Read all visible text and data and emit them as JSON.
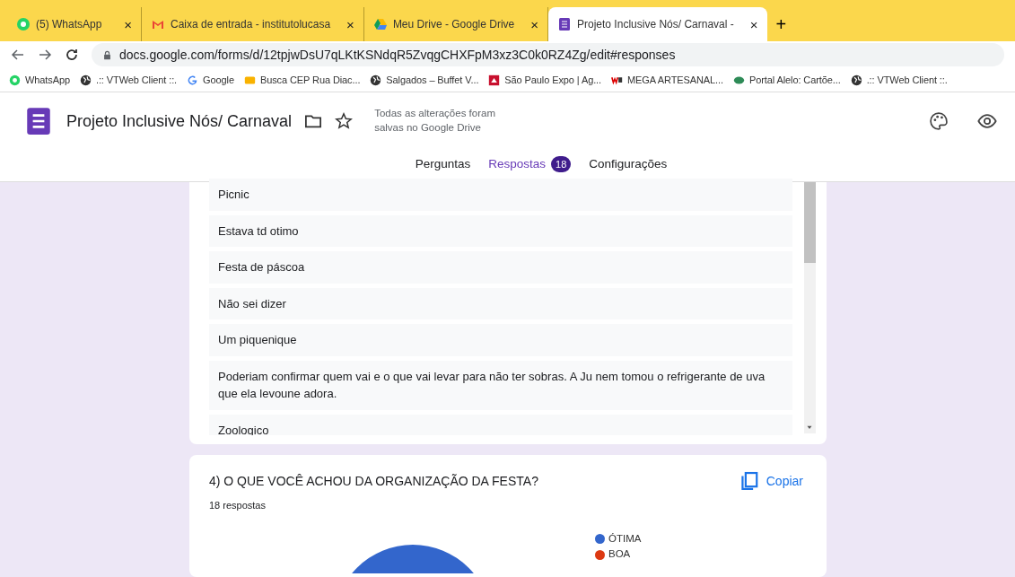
{
  "browser_tabs": [
    {
      "title": "(5) WhatsApp",
      "close": "×",
      "selected": false
    },
    {
      "title": "Caixa de entrada - institutolucasa",
      "close": "×",
      "selected": false
    },
    {
      "title": "Meu Drive - Google Drive",
      "close": "×",
      "selected": false
    },
    {
      "title": "Projeto Inclusive Nós/ Carnaval -",
      "close": "×",
      "selected": true
    }
  ],
  "new_tab": "+",
  "address": "docs.google.com/forms/d/12tpjwDsU7qLKtKSNdqR5ZvqgCHXFpM3xz3C0k0RZ4Zg/edit#responses",
  "bookmarks": [
    {
      "label": "WhatsApp"
    },
    {
      "label": ".:: VTWeb Client ::."
    },
    {
      "label": "Google"
    },
    {
      "label": "Busca CEP Rua Diac..."
    },
    {
      "label": "Salgados – Buffet V..."
    },
    {
      "label": "São Paulo Expo | Ag..."
    },
    {
      "label": "MEGA ARTESANAL..."
    },
    {
      "label": "Portal Alelo: Cartõe..."
    },
    {
      "label": ".:: VTWeb Client ::."
    }
  ],
  "form": {
    "title": "Projeto Inclusive Nós/ Carnaval",
    "save_status": "Todas as alterações foram salvas no Google Drive"
  },
  "form_tabs": [
    {
      "label": "Perguntas",
      "selected": false
    },
    {
      "label": "Respostas",
      "selected": true,
      "badge": "18"
    },
    {
      "label": "Configurações",
      "selected": false
    }
  ],
  "responses": [
    "Picnic",
    "Estava td otimo",
    "Festa de páscoa",
    "Não sei dizer",
    "Um piquenique",
    "Poderiam confirmar quem vai e o que vai levar para não ter sobras. A Ju nem tomou o refrigerante de uva que ela levoune adora.",
    "Zoologico"
  ],
  "question": {
    "title": "4) O QUE VOCÊ ACHOU DA ORGANIZAÇÃO DA FESTA?",
    "count": "18 respostas",
    "copy": "Copiar",
    "legend": [
      {
        "label": "ÓTIMA",
        "color": "#3366cc"
      },
      {
        "label": "BOA",
        "color": "#dc3912"
      }
    ]
  }
}
